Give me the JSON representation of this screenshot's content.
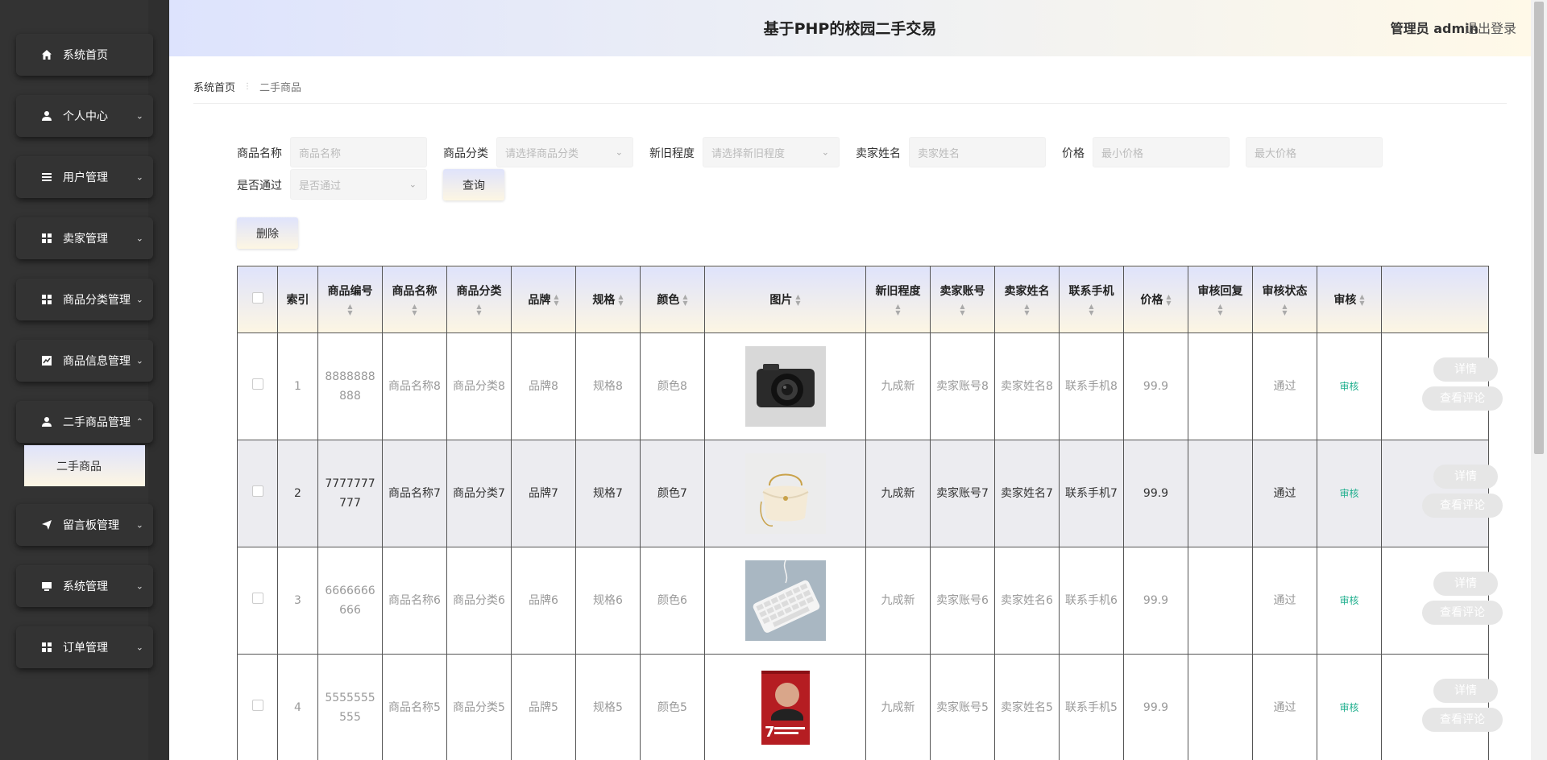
{
  "header": {
    "title": "基于PHP的校园二手交易",
    "user": "管理员 admin",
    "logout": "退出登录"
  },
  "sidebar": {
    "items": [
      {
        "label": "系统首页",
        "icon": "home-icon"
      },
      {
        "label": "个人中心",
        "icon": "user-icon"
      },
      {
        "label": "用户管理",
        "icon": "list-icon"
      },
      {
        "label": "卖家管理",
        "icon": "grid-icon"
      },
      {
        "label": "商品分类管理",
        "icon": "grid-icon"
      },
      {
        "label": "商品信息管理",
        "icon": "chart-icon"
      },
      {
        "label": "二手商品管理",
        "icon": "user-icon"
      },
      {
        "label": "留言板管理",
        "icon": "send-icon"
      },
      {
        "label": "系统管理",
        "icon": "monitor-icon"
      },
      {
        "label": "订单管理",
        "icon": "grid-icon"
      }
    ],
    "active_sub": "二手商品"
  },
  "breadcrumb": {
    "home": "系统首页",
    "current": "二手商品"
  },
  "search": {
    "name_label": "商品名称",
    "name_placeholder": "商品名称",
    "category_label": "商品分类",
    "category_placeholder": "请选择商品分类",
    "condition_label": "新旧程度",
    "condition_placeholder": "请选择新旧程度",
    "seller_label": "卖家姓名",
    "seller_placeholder": "卖家姓名",
    "price_label": "价格",
    "min_price_placeholder": "最小价格",
    "max_price_placeholder": "最大价格",
    "passed_label": "是否通过",
    "passed_placeholder": "是否通过",
    "query_button": "查询",
    "delete_button": "删除"
  },
  "table": {
    "columns": [
      "索引",
      "商品编号",
      "商品名称",
      "商品分类",
      "品牌",
      "规格",
      "颜色",
      "图片",
      "新旧程度",
      "卖家账号",
      "卖家姓名",
      "联系手机",
      "价格",
      "审核回复",
      "审核状态",
      "审核"
    ],
    "rows": [
      {
        "index": "1",
        "code": "8888888888",
        "name": "商品名称8",
        "category": "商品分类8",
        "brand": "品牌8",
        "spec": "规格8",
        "color": "颜色8",
        "image": "camera",
        "condition": "九成新",
        "seller_account": "卖家账号8",
        "seller_name": "卖家姓名8",
        "phone": "联系手机8",
        "price": "99.9",
        "reply": "",
        "status": "通过",
        "audit": "审核"
      },
      {
        "index": "2",
        "code": "7777777777",
        "name": "商品名称7",
        "category": "商品分类7",
        "brand": "品牌7",
        "spec": "规格7",
        "color": "颜色7",
        "image": "bag",
        "condition": "九成新",
        "seller_account": "卖家账号7",
        "seller_name": "卖家姓名7",
        "phone": "联系手机7",
        "price": "99.9",
        "reply": "",
        "status": "通过",
        "audit": "审核"
      },
      {
        "index": "3",
        "code": "6666666666",
        "name": "商品名称6",
        "category": "商品分类6",
        "brand": "品牌6",
        "spec": "规格6",
        "color": "颜色6",
        "image": "keyboard",
        "condition": "九成新",
        "seller_account": "卖家账号6",
        "seller_name": "卖家姓名6",
        "phone": "联系手机6",
        "price": "99.9",
        "reply": "",
        "status": "通过",
        "audit": "审核"
      },
      {
        "index": "4",
        "code": "5555555555",
        "name": "商品名称5",
        "category": "商品分类5",
        "brand": "品牌5",
        "spec": "规格5",
        "color": "颜色5",
        "image": "book",
        "condition": "九成新",
        "seller_account": "卖家账号5",
        "seller_name": "卖家姓名5",
        "phone": "联系手机5",
        "price": "99.9",
        "reply": "",
        "status": "通过",
        "audit": "审核"
      }
    ],
    "detail_button": "详情",
    "comment_button": "查看评论"
  },
  "colors": {
    "accent_gradient_top": "#dfe3fb",
    "accent_gradient_bottom": "#fdf6e3",
    "sidebar_bg": "#333333",
    "audit_link": "#22b08f"
  }
}
